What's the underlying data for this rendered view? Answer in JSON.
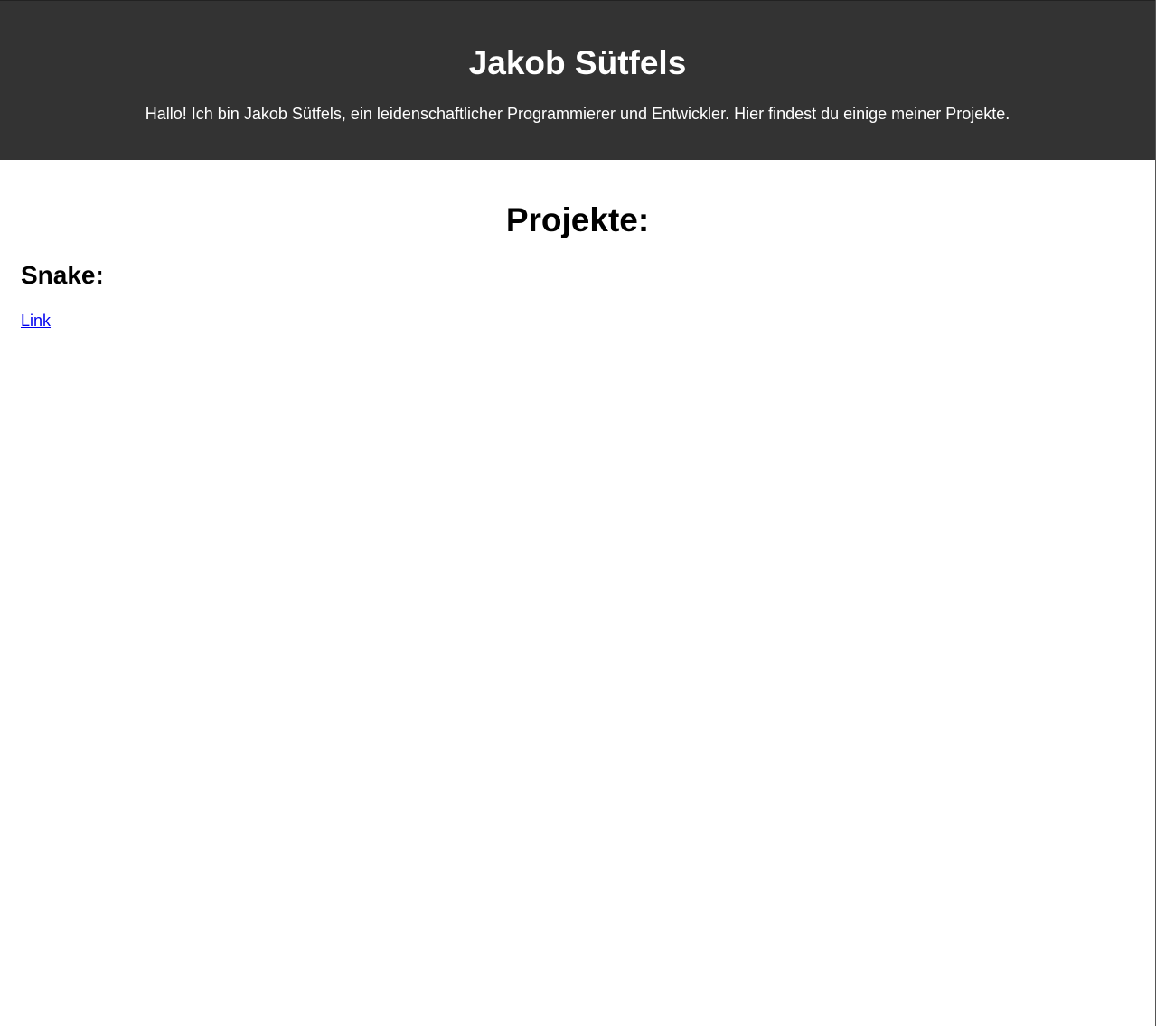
{
  "header": {
    "title": "Jakob Sütfels",
    "intro": "Hallo! Ich bin Jakob Sütfels, ein leidenschaftlicher Programmierer und Entwickler. Hier findest du einige meiner Projekte."
  },
  "projects": {
    "heading": "Projekte:",
    "items": [
      {
        "title": "Snake:",
        "link_label": "Link"
      }
    ]
  },
  "colors": {
    "header_background": "#333333",
    "header_text": "#ffffff",
    "link": "#0000ee"
  }
}
